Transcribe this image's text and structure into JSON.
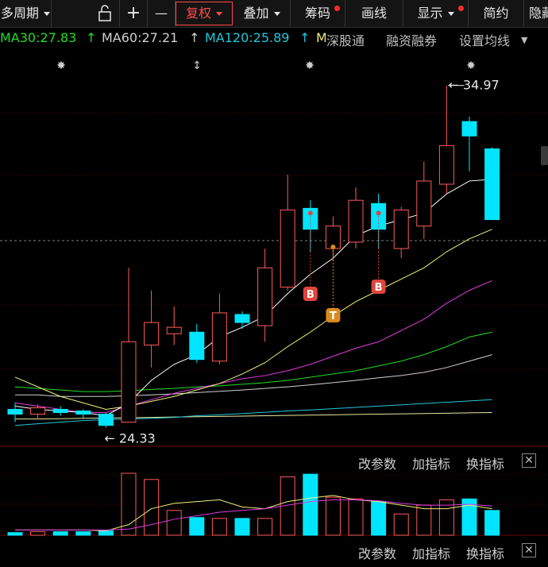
{
  "toolbar": {
    "period_label": "多周期",
    "unlock_icon": "unlock-icon",
    "zoom_in": "+",
    "zoom_out": "—",
    "fuquan_label": "复权",
    "diejia_label": "叠加",
    "chouma_label": "筹码",
    "huaxian_label": "画线",
    "xianshi_label": "显示",
    "jianyue_label": "简约",
    "yincang_label": "隐藏"
  },
  "ma_bar": {
    "ma30": "MA30:27.83",
    "ma60": "MA60:27.21",
    "ma120": "MA120:25.89",
    "ma_more": "M",
    "shenguto": "深股通",
    "rongzi": "融资融券",
    "settings": "设置均线",
    "settings_caret": "▼"
  },
  "price_labels": {
    "high": "34.97",
    "low": "24.33"
  },
  "signals": [
    {
      "label": "B",
      "color": "#e0443c"
    },
    {
      "label": "T",
      "color": "#d98a1e"
    },
    {
      "label": "B",
      "color": "#e0443c"
    }
  ],
  "indicator_bars": [
    {
      "modify": "改参数",
      "add": "加指标",
      "switch": "换指标",
      "close": "✕"
    },
    {
      "modify": "改参数",
      "add": "加指标",
      "switch": "换指标",
      "close": "✕"
    }
  ],
  "colors": {
    "up": "#ff5a5a",
    "down": "#00e5ff",
    "ma30": "#22dd22",
    "ma60": "#d0d0d0",
    "ma120": "#22c7d9",
    "yellow": "#f0f07a",
    "magenta": "#e03be0"
  },
  "chart_data": {
    "type": "candlestick",
    "candles": [
      {
        "o": 24.9,
        "c": 24.75,
        "h": 25.1,
        "l": 24.5
      },
      {
        "o": 24.75,
        "c": 24.95,
        "h": 25.05,
        "l": 24.6
      },
      {
        "o": 24.9,
        "c": 24.8,
        "h": 25.0,
        "l": 24.7
      },
      {
        "o": 24.85,
        "c": 24.75,
        "h": 24.9,
        "l": 24.6
      },
      {
        "o": 24.75,
        "c": 24.4,
        "h": 24.8,
        "l": 24.33
      },
      {
        "o": 24.5,
        "c": 27.0,
        "h": 29.3,
        "l": 24.5
      },
      {
        "o": 26.9,
        "c": 27.6,
        "h": 28.6,
        "l": 26.2
      },
      {
        "o": 27.25,
        "c": 27.45,
        "h": 28.1,
        "l": 26.9
      },
      {
        "o": 27.3,
        "c": 26.45,
        "h": 27.55,
        "l": 26.35
      },
      {
        "o": 26.4,
        "c": 27.9,
        "h": 28.5,
        "l": 26.3
      },
      {
        "o": 27.85,
        "c": 27.6,
        "h": 27.95,
        "l": 27.4
      },
      {
        "o": 27.5,
        "c": 29.3,
        "h": 29.9,
        "l": 27.0
      },
      {
        "o": 28.7,
        "c": 31.1,
        "h": 32.2,
        "l": 28.6
      },
      {
        "o": 31.15,
        "c": 30.5,
        "h": 31.4,
        "l": 29.8
      },
      {
        "o": 29.9,
        "c": 30.6,
        "h": 30.9,
        "l": 29.5
      },
      {
        "o": 30.1,
        "c": 31.4,
        "h": 31.8,
        "l": 29.9
      },
      {
        "o": 31.3,
        "c": 30.5,
        "h": 31.6,
        "l": 29.9
      },
      {
        "o": 29.9,
        "c": 31.1,
        "h": 31.2,
        "l": 29.6
      },
      {
        "o": 30.6,
        "c": 32.0,
        "h": 32.6,
        "l": 30.2
      },
      {
        "o": 31.9,
        "c": 33.1,
        "h": 34.97,
        "l": 31.6
      },
      {
        "o": 33.85,
        "c": 33.4,
        "h": 34.0,
        "l": 32.3
      },
      {
        "o": 33.0,
        "c": 30.8,
        "h": 33.05,
        "l": 30.8
      }
    ],
    "ma5": [
      25.0,
      24.9,
      24.85,
      24.8,
      24.7,
      25.1,
      25.8,
      26.3,
      26.6,
      27.15,
      27.45,
      27.8,
      28.5,
      29.1,
      29.6,
      30.3,
      30.6,
      30.8,
      31.0,
      31.6,
      32.0,
      32.05
    ],
    "ma10": [
      25.9,
      25.6,
      25.3,
      25.1,
      24.9,
      25.0,
      25.15,
      25.3,
      25.5,
      25.7,
      26.0,
      26.35,
      26.85,
      27.3,
      27.8,
      28.25,
      28.6,
      28.95,
      29.3,
      29.8,
      30.2,
      30.5
    ],
    "ma20": [
      25.1,
      25.0,
      24.9,
      24.8,
      24.8,
      25.0,
      25.2,
      25.4,
      25.55,
      25.7,
      25.85,
      25.95,
      26.1,
      26.3,
      26.55,
      26.8,
      27.0,
      27.35,
      27.7,
      28.2,
      28.6,
      28.9
    ],
    "ma30": [
      25.6,
      25.55,
      25.5,
      25.45,
      25.45,
      25.48,
      25.52,
      25.55,
      25.6,
      25.63,
      25.68,
      25.73,
      25.8,
      25.9,
      26.0,
      26.1,
      26.25,
      26.4,
      26.6,
      26.85,
      27.15,
      27.3
    ],
    "ma60": [
      25.35,
      25.35,
      25.3,
      25.3,
      25.3,
      25.32,
      25.35,
      25.38,
      25.42,
      25.46,
      25.5,
      25.55,
      25.6,
      25.66,
      25.73,
      25.8,
      25.88,
      25.95,
      26.05,
      26.2,
      26.4,
      26.6
    ],
    "ma120": [
      24.4,
      24.45,
      24.5,
      24.55,
      24.58,
      24.6,
      24.62,
      24.65,
      24.7,
      24.73,
      24.77,
      24.81,
      24.85,
      24.88,
      24.92,
      24.96,
      25.0,
      25.04,
      25.08,
      25.12,
      25.16,
      25.2
    ],
    "ma250": [
      24.6,
      24.6,
      24.61,
      24.62,
      24.63,
      24.64,
      24.65,
      24.66,
      24.67,
      24.68,
      24.69,
      24.7,
      24.71,
      24.72,
      24.73,
      24.74,
      24.75,
      24.76,
      24.77,
      24.78,
      24.79,
      24.8
    ],
    "volume": [
      3,
      4,
      4,
      4,
      5,
      70,
      63,
      28,
      20,
      19,
      19,
      19,
      66,
      69,
      43,
      41,
      38,
      24,
      34,
      40,
      41,
      28
    ],
    "vol_ma": [
      6,
      6,
      6,
      6,
      5,
      12,
      30,
      36,
      38,
      40,
      32,
      30,
      38,
      42,
      45,
      40,
      38,
      34,
      30,
      30,
      34,
      30
    ],
    "vol_ma2": [
      6,
      6,
      6,
      6,
      6,
      7,
      12,
      18,
      22,
      26,
      28,
      30,
      34,
      38,
      40,
      40,
      39,
      36,
      34,
      34,
      35,
      33
    ],
    "ylim": [
      23.8,
      35.9
    ]
  }
}
